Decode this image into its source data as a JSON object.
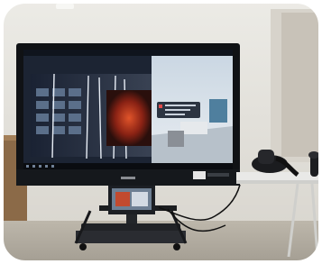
{
  "photo": {
    "monitor_brand": "",
    "sticker": "",
    "screen_popup": ""
  }
}
